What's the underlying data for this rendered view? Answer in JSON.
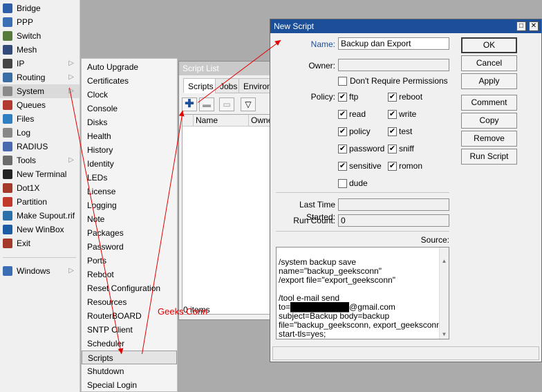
{
  "main_menu": {
    "items": [
      {
        "label": "Bridge",
        "icon": "bridge-icon",
        "color": "#2e5ea8",
        "submenu": false
      },
      {
        "label": "PPP",
        "icon": "ppp-icon",
        "color": "#3a6fb3",
        "submenu": false
      },
      {
        "label": "Switch",
        "icon": "switch-icon",
        "color": "#557a3b",
        "submenu": false
      },
      {
        "label": "Mesh",
        "icon": "mesh-icon",
        "color": "#334b7a",
        "submenu": false
      },
      {
        "label": "IP",
        "icon": "ip-icon",
        "color": "#444444",
        "submenu": true
      },
      {
        "label": "Routing",
        "icon": "routing-icon",
        "color": "#3b6ea5",
        "submenu": true
      },
      {
        "label": "System",
        "icon": "gear-icon",
        "color": "#8a8a8a",
        "submenu": true
      },
      {
        "label": "Queues",
        "icon": "queues-icon",
        "color": "#b33a2e",
        "submenu": false
      },
      {
        "label": "Files",
        "icon": "folder-icon",
        "color": "#2f7fc1",
        "submenu": false
      },
      {
        "label": "Log",
        "icon": "log-icon",
        "color": "#888888",
        "submenu": false
      },
      {
        "label": "RADIUS",
        "icon": "radius-icon",
        "color": "#4a6ab0",
        "submenu": false
      },
      {
        "label": "Tools",
        "icon": "tools-icon",
        "color": "#6b6b6b",
        "submenu": true
      },
      {
        "label": "New Terminal",
        "icon": "terminal-icon",
        "color": "#222222",
        "submenu": false
      },
      {
        "label": "Dot1X",
        "icon": "dot1x-icon",
        "color": "#a33a2a",
        "submenu": false
      },
      {
        "label": "Partition",
        "icon": "partition-icon",
        "color": "#c0392b",
        "submenu": false
      },
      {
        "label": "Make Supout.rif",
        "icon": "supout-icon",
        "color": "#2d6fa8",
        "submenu": false
      },
      {
        "label": "New WinBox",
        "icon": "winbox-icon",
        "color": "#1f5ca6",
        "submenu": false
      },
      {
        "label": "Exit",
        "icon": "exit-icon",
        "color": "#a33a2a",
        "submenu": false
      },
      {
        "label": "Windows",
        "icon": "windows-icon",
        "color": "#3a6fb3",
        "submenu": true
      }
    ],
    "selected": "System"
  },
  "system_submenu": {
    "items": [
      "Auto Upgrade",
      "Certificates",
      "Clock",
      "Console",
      "Disks",
      "Health",
      "History",
      "Identity",
      "LEDs",
      "License",
      "Logging",
      "Note",
      "Packages",
      "Password",
      "Ports",
      "Reboot",
      "Reset Configuration",
      "Resources",
      "RouterBOARD",
      "SNTP Client",
      "Scheduler",
      "Scripts",
      "Shutdown",
      "Special Login"
    ],
    "selected": "Scripts"
  },
  "script_list": {
    "title": "Script List",
    "tabs": [
      "Scripts",
      "Jobs",
      "Environment"
    ],
    "active_tab": "Scripts",
    "toolbar": {
      "add": "add-icon",
      "remove": "remove-icon",
      "comment": "comment-icon",
      "filter": "filter-icon"
    },
    "columns": [
      "Name",
      "Owner"
    ],
    "status": "0 items"
  },
  "new_script": {
    "title": "New Script",
    "name_label": "Name:",
    "name_value": "Backup dan Export",
    "owner_label": "Owner:",
    "owner_value": "",
    "dont_require_label": "Don't Require Permissions",
    "policy_label": "Policy:",
    "policies": [
      {
        "label": "ftp",
        "checked": true
      },
      {
        "label": "reboot",
        "checked": true
      },
      {
        "label": "read",
        "checked": true
      },
      {
        "label": "write",
        "checked": true
      },
      {
        "label": "policy",
        "checked": true
      },
      {
        "label": "test",
        "checked": true
      },
      {
        "label": "password",
        "checked": true
      },
      {
        "label": "sniff",
        "checked": true
      },
      {
        "label": "sensitive",
        "checked": true
      },
      {
        "label": "romon",
        "checked": true
      },
      {
        "label": "dude",
        "checked": false
      }
    ],
    "last_started_label": "Last Time Started:",
    "last_started_value": "",
    "run_count_label": "Run Count:",
    "run_count_value": "0",
    "source_label": "Source:",
    "source_lines": [
      "/system backup save",
      "name=\"backup_geeksconn\"",
      "/export file=\"export_geeksconn\"",
      "",
      "/tool e-mail send to=██████████@gmail.com",
      "subject=Backup body=backup",
      "file=\"backup_geeksconn, export_geeksconn\"",
      "start-tls=yes;"
    ],
    "buttons": {
      "ok": "OK",
      "cancel": "Cancel",
      "apply": "Apply",
      "comment": "Comment",
      "copy": "Copy",
      "remove": "Remove",
      "run": "Run Script"
    }
  },
  "watermark": "Geeks Conn",
  "colors": {
    "title_active": "#1c4f9a",
    "arrow": "#e00000"
  }
}
